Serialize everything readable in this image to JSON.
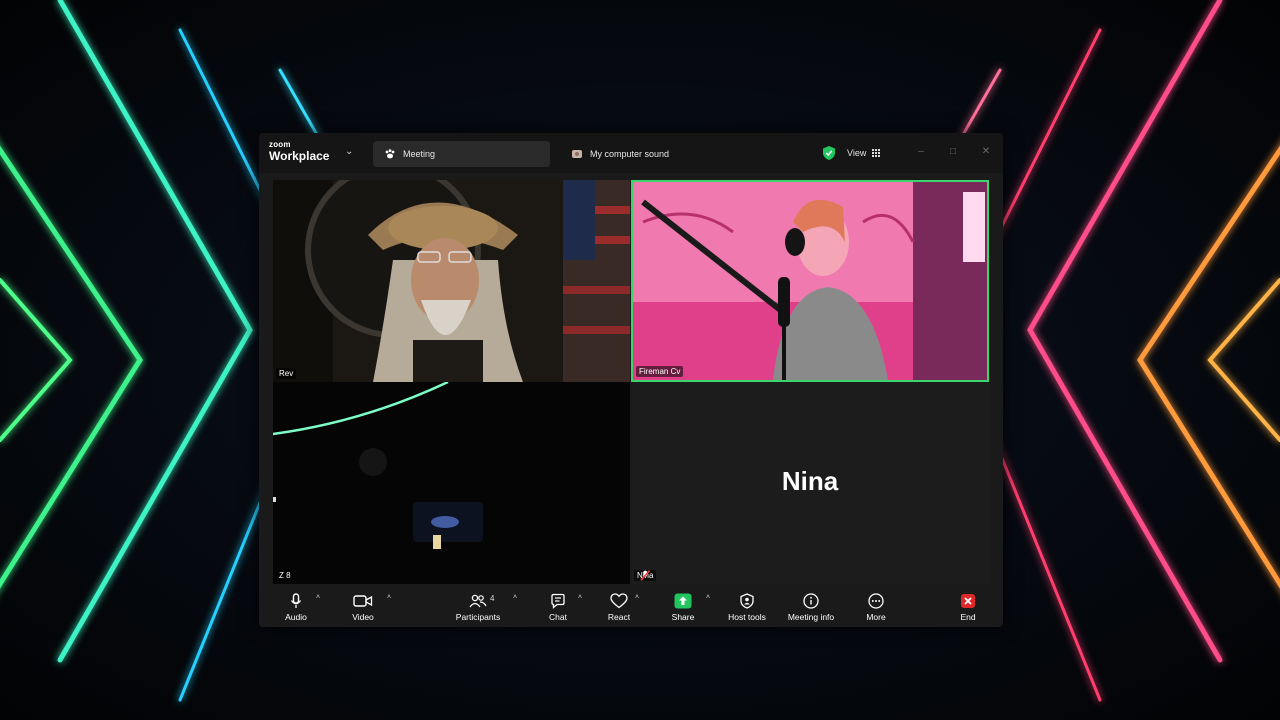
{
  "app": {
    "logo_small": "zoom",
    "logo_big": "Workplace"
  },
  "tabs": [
    {
      "label": "Meeting",
      "icon": "paw-icon"
    },
    {
      "label": "My computer sound",
      "icon": "speaker-icon"
    }
  ],
  "view_label": "View",
  "participants": [
    {
      "name": "Rev"
    },
    {
      "name": "Fireman Cv"
    },
    {
      "name": "Z 8"
    },
    {
      "name": "Nina",
      "muted": true
    }
  ],
  "toolbar": {
    "audio": "Audio",
    "video": "Video",
    "participants": "Participants",
    "participant_count": "4",
    "chat": "Chat",
    "react": "React",
    "share": "Share",
    "host_tools": "Host tools",
    "meeting_info": "Meeting info",
    "more": "More",
    "end": "End"
  },
  "colors": {
    "active_speaker": "#3ad56b",
    "share": "#22c55e",
    "end": "#e02828"
  }
}
